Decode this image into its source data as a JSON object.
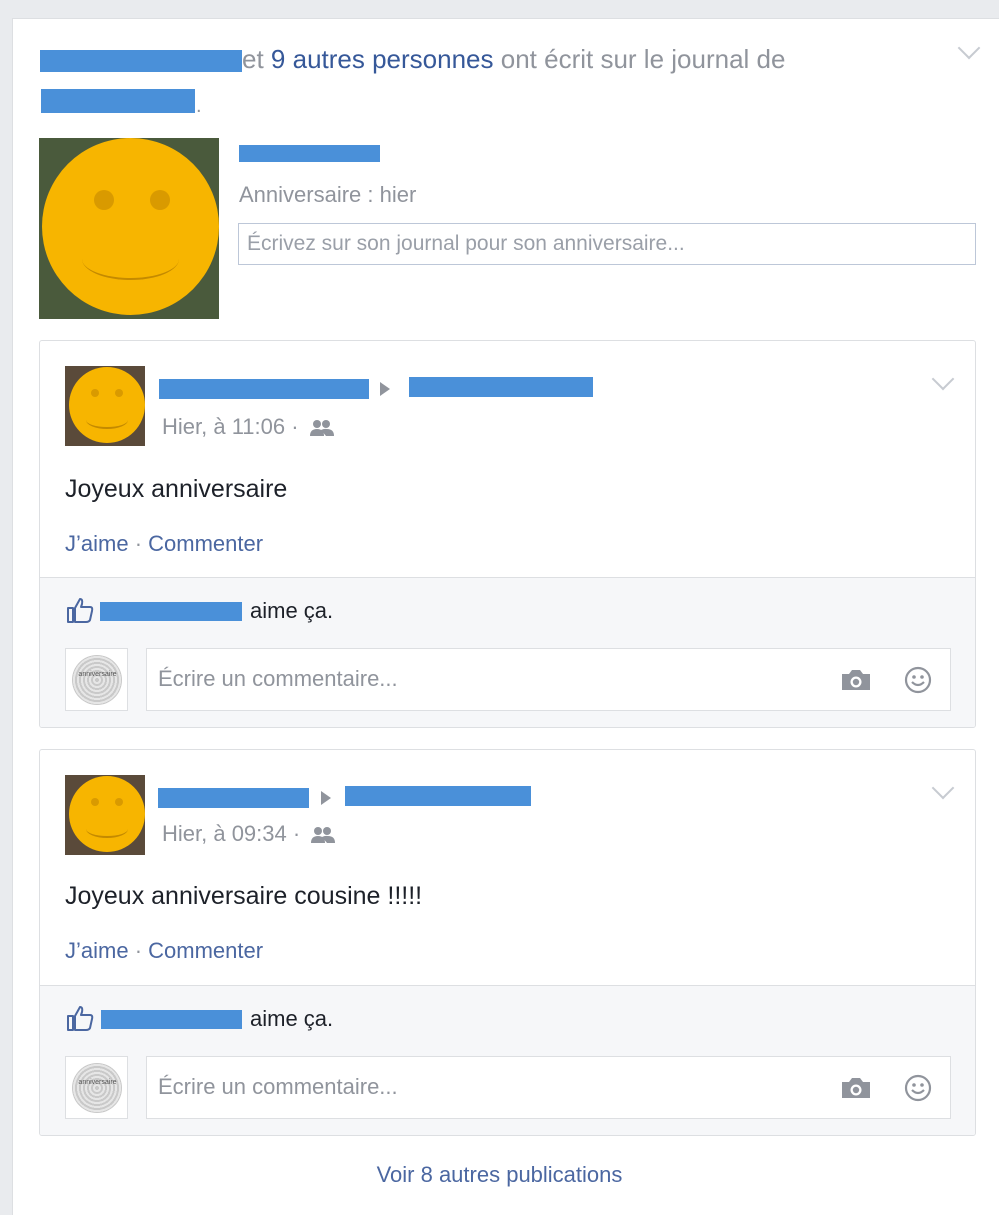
{
  "header": {
    "connector": " et ",
    "others_link": "9 autres personnes",
    "suffix": " ont écrit sur le journal de",
    "period": "."
  },
  "birthday": {
    "subtitle": "Anniversaire : hier",
    "input_placeholder": "Écrivez sur son journal pour son anniversaire..."
  },
  "posts": [
    {
      "time": "Hier, à 11:06 · ",
      "message": "Joyeux anniversaire",
      "like_action": "J’aime",
      "separator": " · ",
      "comment_action": "Commenter",
      "likes_suffix": "aime ça.",
      "comment_placeholder": "Écrire un commentaire..."
    },
    {
      "time": "Hier, à 09:34 · ",
      "message": "Joyeux anniversaire cousine !!!!!",
      "like_action": "J’aime",
      "separator": " · ",
      "comment_action": "Commenter",
      "likes_suffix": "aime ça.",
      "comment_placeholder": "Écrire un commentaire..."
    }
  ],
  "avatar_seal_text": "anniversaire",
  "more_link": "Voir 8 autres publications",
  "colors": {
    "redaction": "#4a90d9",
    "link": "#365899",
    "action": "#4b67a1",
    "smiley": "#f7b500"
  },
  "icons": [
    "chevron-down-icon",
    "audience-friends-icon",
    "like-thumb-icon",
    "camera-icon",
    "emoji-icon",
    "arrow-right-icon"
  ]
}
